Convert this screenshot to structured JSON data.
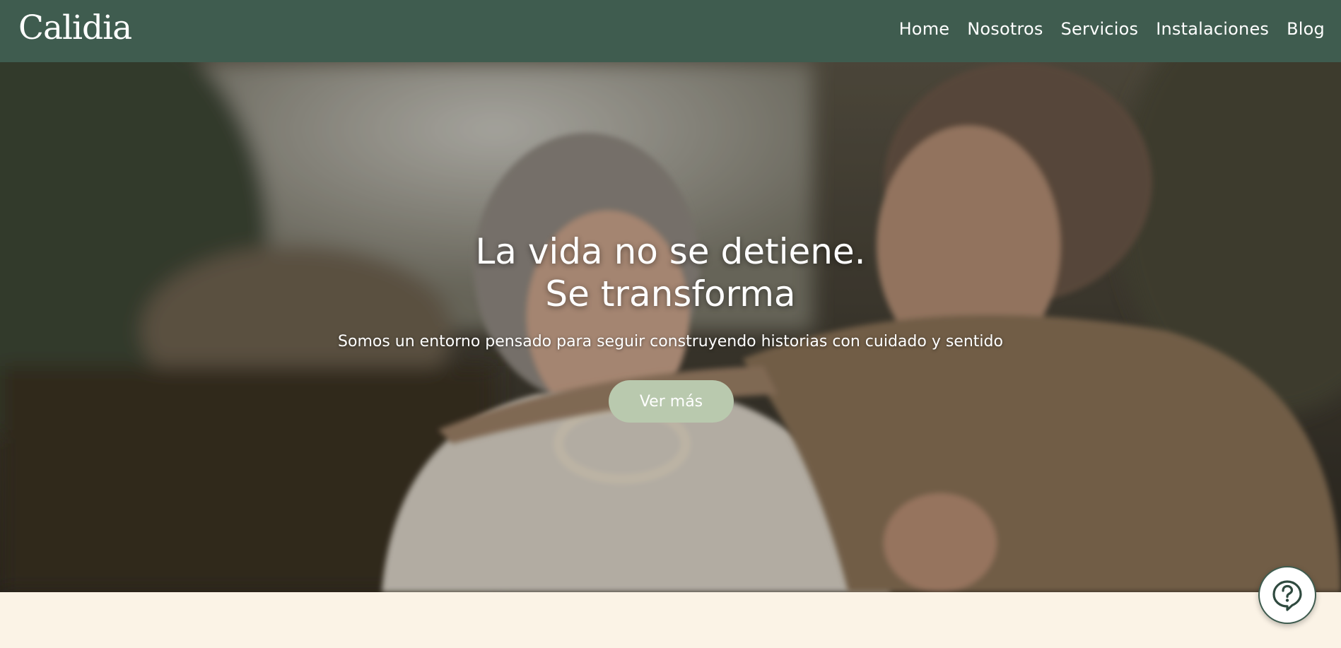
{
  "brand": {
    "logo_text": "Calidia"
  },
  "nav": {
    "items": [
      {
        "label": "Home"
      },
      {
        "label": "Nosotros"
      },
      {
        "label": "Servicios"
      },
      {
        "label": "Instalaciones"
      },
      {
        "label": "Blog"
      }
    ]
  },
  "hero": {
    "title_line1": "La vida no se detiene.",
    "title_line2": "Se transforma",
    "subtitle": "Somos un entorno pensado para seguir construyendo historias con cuidado y sentido",
    "cta_label": "Ver más"
  },
  "help": {
    "icon": "question-bubble-icon"
  },
  "colors": {
    "header_bg": "#3f5c4f",
    "button_bg": "#b9c9ae",
    "page_bg": "#fbf3e6"
  }
}
